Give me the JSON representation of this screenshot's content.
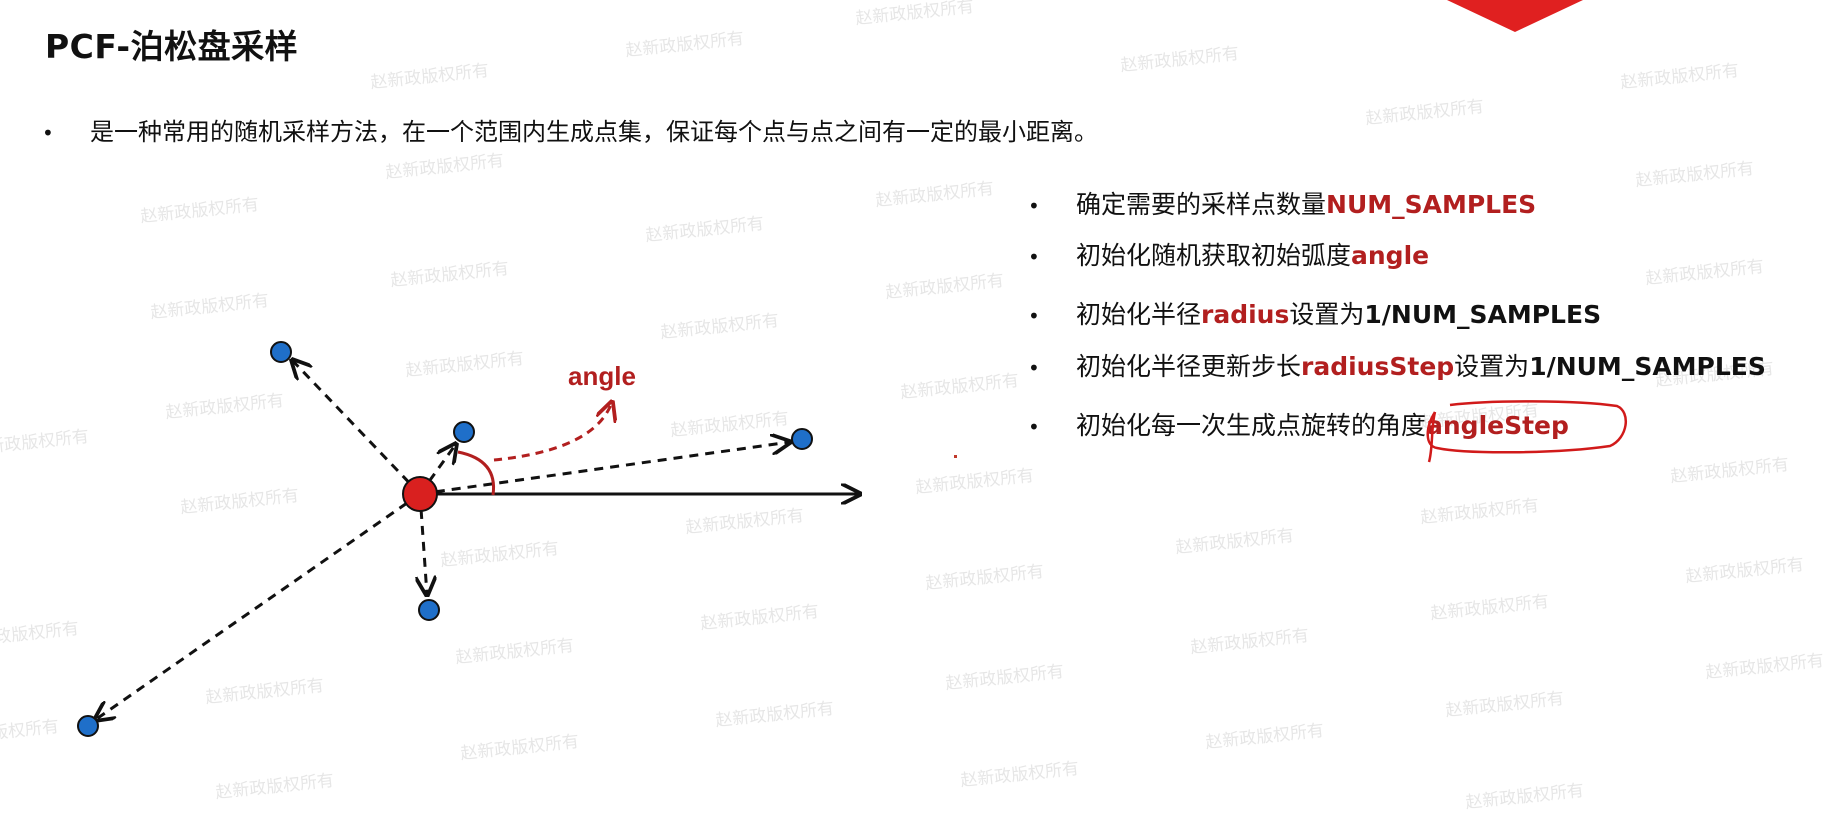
{
  "slide": {
    "title": "PCF-泊松盘采样",
    "intro_bullet": "•",
    "intro_text": "是一种常用的随机采样方法，在一个范围内生成点集，保证每个点与点之间有一定的最小距离。",
    "watermark_text": "赵新政版权所有"
  },
  "steps": [
    {
      "bullet": "•",
      "pre": "确定需要的采样点数量",
      "highlight": "NUM_SAMPLES",
      "post": ""
    },
    {
      "bullet": "•",
      "pre": "初始化随机获取初始弧度",
      "highlight": "angle",
      "post": ""
    },
    {
      "bullet": "•",
      "pre": "初始化半径",
      "highlight": "radius",
      "post": "设置为",
      "post_bold": "1/NUM_SAMPLES"
    },
    {
      "bullet": "•",
      "pre": "初始化半径更新步长",
      "highlight": "radiusStep",
      "post": "设置为",
      "post_bold": "1/NUM_SAMPLES"
    },
    {
      "bullet": "•",
      "pre": "初始化每一次生成点旋转的角度",
      "highlight": "angleStep",
      "post": ""
    }
  ],
  "diagram": {
    "angle_label": "angle"
  },
  "colors": {
    "accent_red": "#b21f1f",
    "center_point": "#d9201f",
    "sample_point": "#1f6fc9",
    "corner_red": "#e02020"
  }
}
